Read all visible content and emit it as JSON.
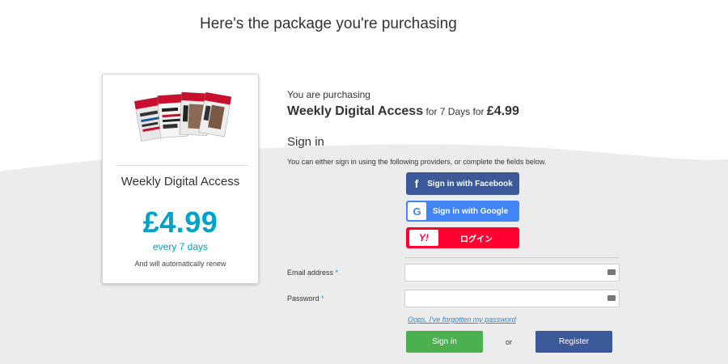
{
  "page": {
    "title": "Here's the package you're purchasing"
  },
  "package": {
    "name": "Weekly Digital Access",
    "price": "£4.99",
    "period": "every 7 days",
    "renew_note": "And will automatically renew",
    "image_alt": "Men's Health magazine covers"
  },
  "purchase": {
    "label": "You are purchasing",
    "product": "Weekly Digital Access",
    "for_days": "for 7 Days for",
    "price": "£4.99"
  },
  "signin": {
    "heading": "Sign in",
    "description": "You can either sign in using the following providers, or complete the fields below.",
    "providers": {
      "facebook": {
        "label": "Sign in with Facebook",
        "icon": "facebook-icon",
        "color": "#3b5998"
      },
      "google": {
        "label": "Sign in with Google",
        "icon": "google-icon",
        "color": "#4285f4"
      },
      "yahoo": {
        "label": "ログイン",
        "icon": "yahoo-icon",
        "icon_text": "Y!",
        "color": "#ff0033"
      }
    }
  },
  "form": {
    "email_label": "Email address",
    "password_label": "Password",
    "required_mark": "*",
    "email_value": "",
    "password_value": "",
    "forgot_link": "Oops, I've forgotten my password",
    "signin_button": "Sign in",
    "or_text": "or",
    "register_button": "Register"
  },
  "colors": {
    "accent": "#00a2c7",
    "signin_green": "#4caf50",
    "register_blue": "#3b5998"
  }
}
